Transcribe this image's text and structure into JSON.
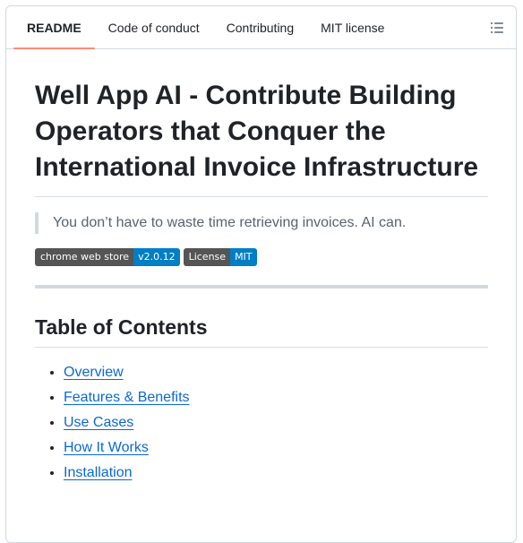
{
  "tabs": [
    {
      "label": "README",
      "active": true
    },
    {
      "label": "Code of conduct",
      "active": false
    },
    {
      "label": "Contributing",
      "active": false
    },
    {
      "label": "MIT license",
      "active": false
    }
  ],
  "toc_button_icon": "list-unordered-icon",
  "readme": {
    "title": "Well App AI - Contribute Building Operators that Conquer the International Invoice Infrastructure",
    "quote": "You don’t have to waste time retrieving invoices. AI can.",
    "badges": [
      {
        "label": "chrome web store",
        "value": "v2.0.12",
        "label_color": "#555555",
        "value_color": "#007ec6"
      },
      {
        "label": "License",
        "value": "MIT",
        "label_color": "#555555",
        "value_color": "#007ec6"
      }
    ],
    "toc_heading": "Table of Contents",
    "toc_items": [
      {
        "label": "Overview"
      },
      {
        "label": "Features & Benefits"
      },
      {
        "label": "Use Cases"
      },
      {
        "label": "How It Works"
      },
      {
        "label": "Installation"
      }
    ]
  },
  "colors": {
    "link": "#0969da",
    "active_tab_underline": "#fd8c73",
    "border": "#d1d9e0",
    "muted_text": "#59636e"
  }
}
